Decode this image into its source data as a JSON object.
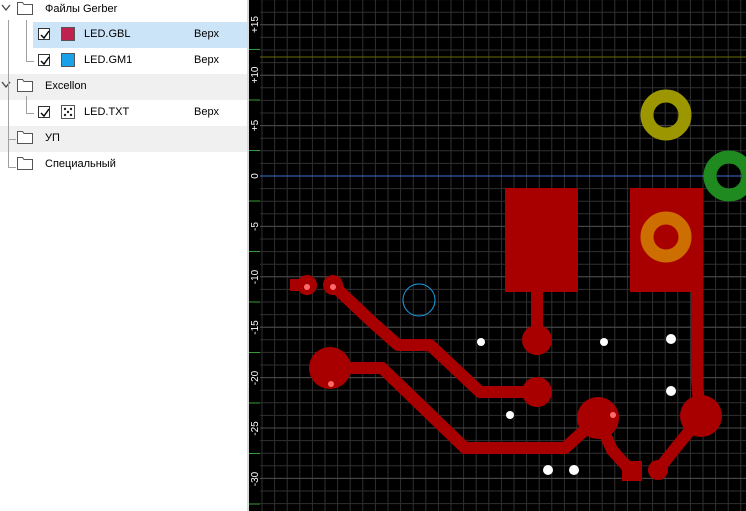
{
  "tree": {
    "groups": [
      {
        "label": "Файлы Gerber",
        "files": [
          {
            "name": "LED.GBL",
            "side": "Верх",
            "checked": true,
            "color": "#c0214e",
            "selected": true
          },
          {
            "name": "LED.GM1",
            "side": "Верх",
            "checked": true,
            "color": "#1aa1ea",
            "selected": false
          }
        ]
      },
      {
        "label": "Excellon",
        "files": [
          {
            "name": "LED.TXT",
            "side": "Верх",
            "checked": true,
            "icon": "drill-icon"
          }
        ]
      },
      {
        "label": "УП"
      },
      {
        "label": "Специальный"
      }
    ]
  },
  "viewer": {
    "background": "#000000",
    "grid_color": "#3a3a3a",
    "copper_color": "#a80000",
    "ruler_labels": [
      "+15",
      "+10",
      "+5",
      "0",
      "-5",
      "-10",
      "-15",
      "-20",
      "-25",
      "-30"
    ],
    "colors": {
      "axis_x": "#3b6fd0",
      "axis_y": "#ffff00",
      "marker_yellow": "#9c9600",
      "marker_green": "#1f8a1f",
      "marker_orange": "#d07a00",
      "drill": "#ffffff",
      "circle": "#1aa1ea"
    }
  }
}
